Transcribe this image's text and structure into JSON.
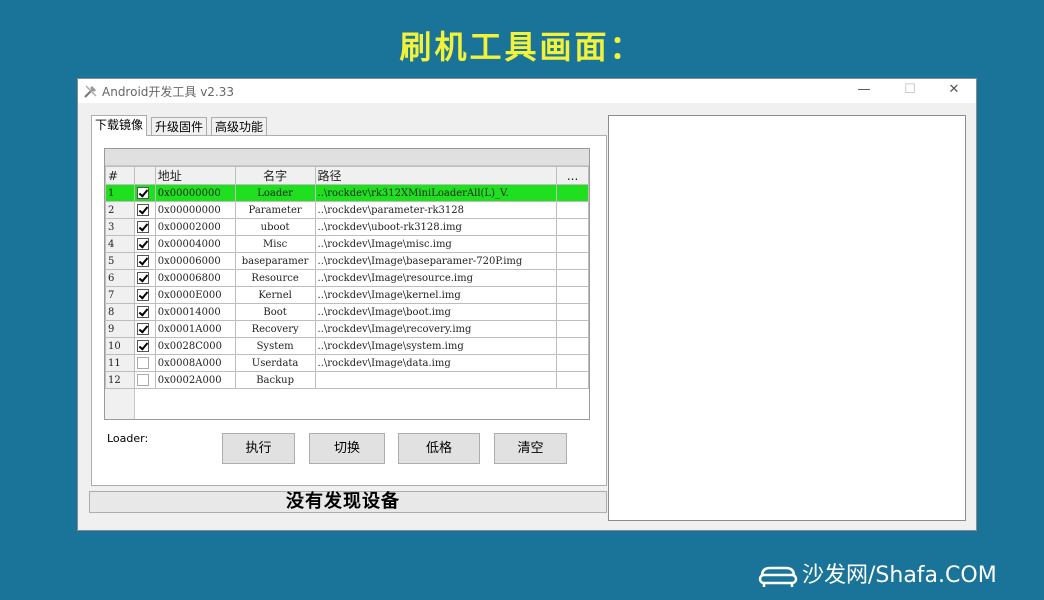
{
  "headline": "刷机工具画面：",
  "window": {
    "title": "Android开发工具 v2.33",
    "controls": {
      "minimize": "—",
      "maximize": "☐",
      "close": "✕"
    }
  },
  "tabs": [
    "下载镜像",
    "升级固件",
    "高级功能"
  ],
  "table": {
    "headers": [
      "#",
      "",
      "地址",
      "名字",
      "路径",
      "..."
    ],
    "rows": [
      {
        "num": "1",
        "checked": true,
        "addr": "0x00000000",
        "name": "Loader",
        "path": "..\\rockdev\\rk312XMiniLoaderAll(L)_V.",
        "highlight": true
      },
      {
        "num": "2",
        "checked": true,
        "addr": "0x00000000",
        "name": "Parameter",
        "path": "..\\rockdev\\parameter-rk3128"
      },
      {
        "num": "3",
        "checked": true,
        "addr": "0x00002000",
        "name": "uboot",
        "path": "..\\rockdev\\uboot-rk3128.img"
      },
      {
        "num": "4",
        "checked": true,
        "addr": "0x00004000",
        "name": "Misc",
        "path": "..\\rockdev\\Image\\misc.img"
      },
      {
        "num": "5",
        "checked": true,
        "addr": "0x00006000",
        "name": "baseparamer",
        "path": "..\\rockdev\\Image\\baseparamer-720P.img"
      },
      {
        "num": "6",
        "checked": true,
        "addr": "0x00006800",
        "name": "Resource",
        "path": "..\\rockdev\\Image\\resource.img"
      },
      {
        "num": "7",
        "checked": true,
        "addr": "0x0000E000",
        "name": "Kernel",
        "path": "..\\rockdev\\Image\\kernel.img"
      },
      {
        "num": "8",
        "checked": true,
        "addr": "0x00014000",
        "name": "Boot",
        "path": "..\\rockdev\\Image\\boot.img"
      },
      {
        "num": "9",
        "checked": true,
        "addr": "0x0001A000",
        "name": "Recovery",
        "path": "..\\rockdev\\Image\\recovery.img"
      },
      {
        "num": "10",
        "checked": true,
        "addr": "0x0028C000",
        "name": "System",
        "path": "..\\rockdev\\Image\\system.img"
      },
      {
        "num": "11",
        "checked": false,
        "addr": "0x0008A000",
        "name": "Userdata",
        "path": "..\\rockdev\\Image\\data.img"
      },
      {
        "num": "12",
        "checked": false,
        "addr": "0x0002A000",
        "name": "Backup",
        "path": ""
      }
    ]
  },
  "loader_label": "Loader:",
  "buttons": {
    "run": "执行",
    "switch": "切换",
    "erase": "低格",
    "clear": "清空"
  },
  "status": "没有发现设备",
  "watermark": "沙发网/Shafa.COM",
  "colors": {
    "background": "#1a7499",
    "headline": "#f3f23a",
    "row_highlight": "#1ee01e"
  }
}
